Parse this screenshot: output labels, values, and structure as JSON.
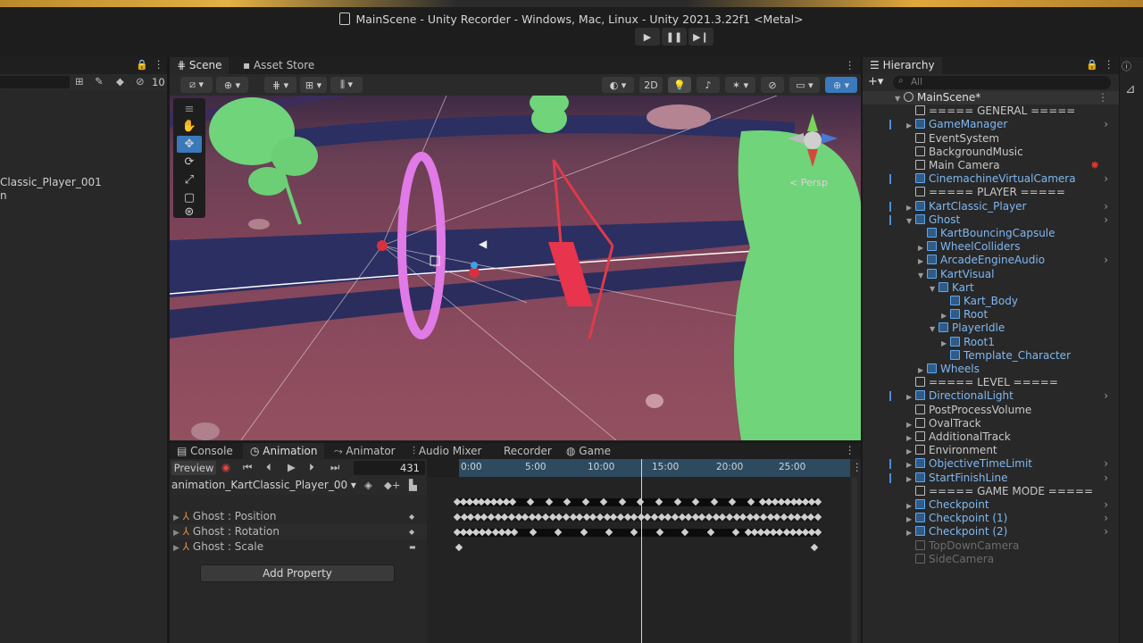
{
  "window": {
    "title": "MainScene - Unity Recorder - Windows, Mac, Linux - Unity 2021.3.22f1 <Metal>"
  },
  "playbar": {
    "play": "▶",
    "pause": "❚❚",
    "step": "▶❙"
  },
  "left_panel": {
    "layers_count": "10",
    "selected_object": "Classic_Player_001",
    "sub_label": "n"
  },
  "scene": {
    "tabs": [
      {
        "label": "Scene"
      },
      {
        "label": "Asset Store"
      }
    ],
    "toolbar_2d": "2D",
    "gizmo_label": "< Persp"
  },
  "bottom": {
    "tabs": [
      {
        "label": "Console"
      },
      {
        "label": "Animation"
      },
      {
        "label": "Animator"
      },
      {
        "label": "Audio Mixer"
      },
      {
        "label": "Recorder"
      },
      {
        "label": "Game"
      }
    ],
    "preview_label": "Preview",
    "frame": "431",
    "clip_name": "animation_KartClassic_Player_00",
    "properties": [
      {
        "label": "Ghost : Position"
      },
      {
        "label": "Ghost : Rotation"
      },
      {
        "label": "Ghost : Scale"
      }
    ],
    "add_property": "Add Property",
    "ruler": [
      "0:00",
      "5:00",
      "10:00",
      "15:00",
      "20:00",
      "25:00"
    ]
  },
  "hierarchy": {
    "title": "Hierarchy",
    "search_placeholder": "All",
    "items": [
      {
        "label": "MainScene*",
        "kind": "scene"
      },
      {
        "label": "===== GENERAL =====",
        "kind": "normal"
      },
      {
        "label": "GameManager",
        "kind": "prefab"
      },
      {
        "label": "EventSystem",
        "kind": "normal"
      },
      {
        "label": "BackgroundMusic",
        "kind": "normal"
      },
      {
        "label": "Main Camera",
        "kind": "normal"
      },
      {
        "label": "CinemachineVirtualCamera",
        "kind": "prefab"
      },
      {
        "label": "===== PLAYER =====",
        "kind": "normal"
      },
      {
        "label": "KartClassic_Player",
        "kind": "prefab"
      },
      {
        "label": "Ghost",
        "kind": "prefab"
      },
      {
        "label": "KartBouncingCapsule",
        "kind": "prefab"
      },
      {
        "label": "WheelColliders",
        "kind": "prefab"
      },
      {
        "label": "ArcadeEngineAudio",
        "kind": "prefab"
      },
      {
        "label": "KartVisual",
        "kind": "prefab"
      },
      {
        "label": "Kart",
        "kind": "prefab"
      },
      {
        "label": "Kart_Body",
        "kind": "prefab"
      },
      {
        "label": "Root",
        "kind": "prefab"
      },
      {
        "label": "PlayerIdle",
        "kind": "prefab"
      },
      {
        "label": "Root1",
        "kind": "prefab"
      },
      {
        "label": "Template_Character",
        "kind": "prefab"
      },
      {
        "label": "Wheels",
        "kind": "prefab"
      },
      {
        "label": "===== LEVEL =====",
        "kind": "normal"
      },
      {
        "label": "DirectionalLight",
        "kind": "prefab"
      },
      {
        "label": "PostProcessVolume",
        "kind": "normal"
      },
      {
        "label": "OvalTrack",
        "kind": "normal"
      },
      {
        "label": "AdditionalTrack",
        "kind": "normal"
      },
      {
        "label": "Environment",
        "kind": "normal"
      },
      {
        "label": "ObjectiveTimeLimit",
        "kind": "prefab"
      },
      {
        "label": "StartFinishLine",
        "kind": "prefab"
      },
      {
        "label": "===== GAME MODE =====",
        "kind": "normal"
      },
      {
        "label": "Checkpoint",
        "kind": "prefab"
      },
      {
        "label": "Checkpoint (1)",
        "kind": "prefab"
      },
      {
        "label": "Checkpoint (2)",
        "kind": "prefab"
      },
      {
        "label": "TopDownCamera",
        "kind": "disabled"
      },
      {
        "label": "SideCamera",
        "kind": "disabled"
      }
    ]
  },
  "colors": {
    "accent": "#3a79bb",
    "prefab": "#7fb8f2",
    "ring": "#e07ae6",
    "foliage": "#6fd47a",
    "track": "#2c2f62"
  }
}
